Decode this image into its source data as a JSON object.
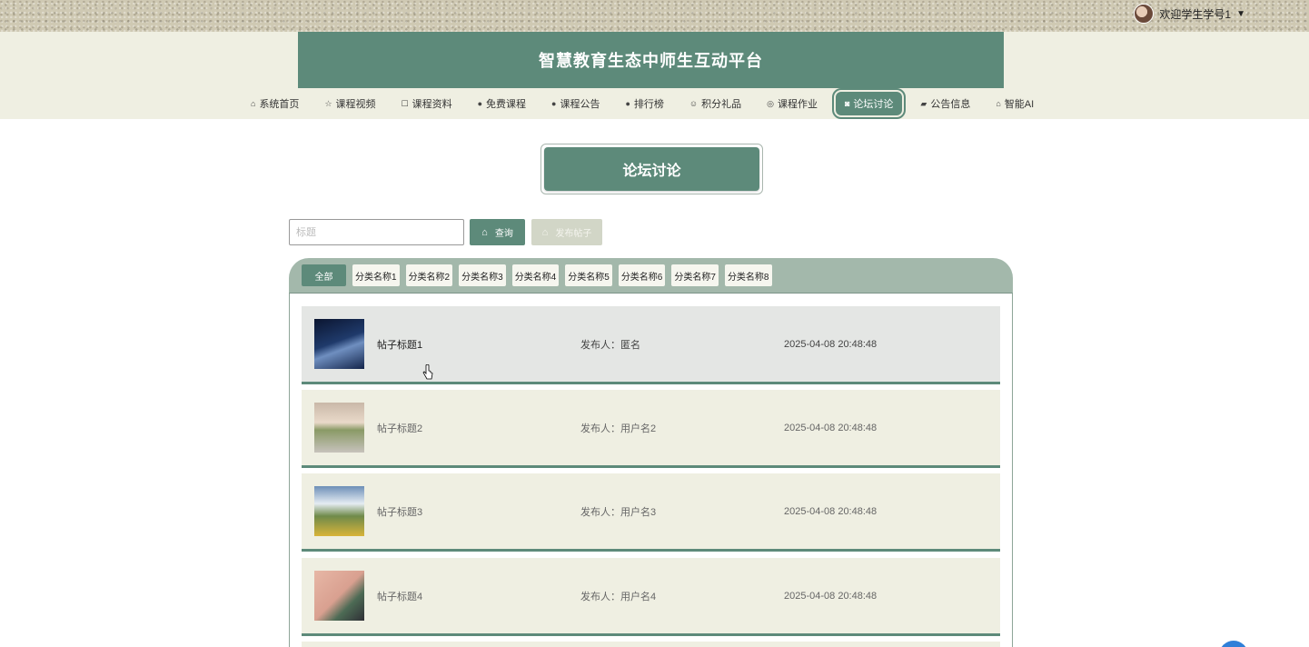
{
  "user": {
    "greeting": "欢迎学生学号1",
    "caret": "▼"
  },
  "site_title": "智慧教育生态中师生互动平台",
  "nav": [
    {
      "label": "系统首页",
      "icon": "home-icon",
      "glyph": "⌂"
    },
    {
      "label": "课程视频",
      "icon": "star-icon",
      "glyph": "☆"
    },
    {
      "label": "课程资料",
      "icon": "folder-icon",
      "glyph": "☐"
    },
    {
      "label": "免费课程",
      "icon": "info-icon",
      "glyph": "●"
    },
    {
      "label": "课程公告",
      "icon": "question-icon",
      "glyph": "●"
    },
    {
      "label": "排行榜",
      "icon": "info-icon",
      "glyph": "●"
    },
    {
      "label": "积分礼品",
      "icon": "smile-icon",
      "glyph": "☺"
    },
    {
      "label": "课程作业",
      "icon": "check-circle-icon",
      "glyph": "◎"
    },
    {
      "label": "论坛讨论",
      "icon": "camera-icon",
      "glyph": "◙",
      "active": true
    },
    {
      "label": "公告信息",
      "icon": "truck-icon",
      "glyph": "▰"
    },
    {
      "label": "智能AI",
      "icon": "home-icon",
      "glyph": "⌂"
    }
  ],
  "page_heading": "论坛讨论",
  "search": {
    "placeholder": "标题",
    "value": ""
  },
  "buttons": {
    "query": "查询",
    "post": "发布帖子"
  },
  "categories": [
    "全部",
    "分类名称1",
    "分类名称2",
    "分类名称3",
    "分类名称4",
    "分类名称5",
    "分类名称6",
    "分类名称7",
    "分类名称8"
  ],
  "posts": [
    {
      "title": "帖子标题1",
      "author": "发布人：匿名",
      "time": "2025-04-08 20:48:48"
    },
    {
      "title": "帖子标题2",
      "author": "发布人：用户名2",
      "time": "2025-04-08 20:48:48"
    },
    {
      "title": "帖子标题3",
      "author": "发布人：用户名3",
      "time": "2025-04-08 20:48:48"
    },
    {
      "title": "帖子标题4",
      "author": "发布人：用户名4",
      "time": "2025-04-08 20:48:48"
    }
  ],
  "colors": {
    "primary": "#5d8a7a",
    "panel_head": "#a3b8ab",
    "row_bg": "#efefe2",
    "fab": "#2f7fd8"
  }
}
